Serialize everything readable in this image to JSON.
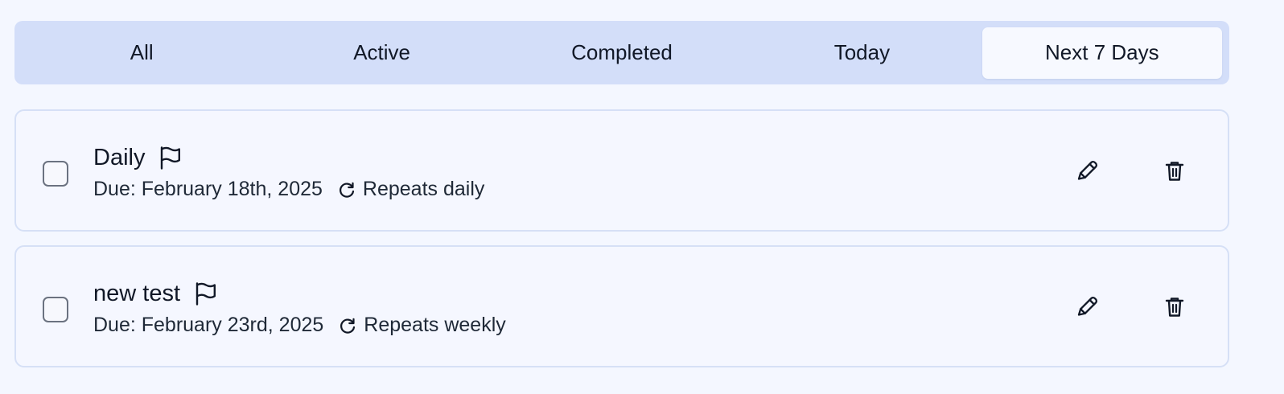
{
  "tabs": {
    "items": [
      {
        "label": "All",
        "active": false
      },
      {
        "label": "Active",
        "active": false
      },
      {
        "label": "Completed",
        "active": false
      },
      {
        "label": "Today",
        "active": false
      },
      {
        "label": "Next 7 Days",
        "active": true
      }
    ]
  },
  "tasks": [
    {
      "title": "Daily",
      "due": "Due: February 18th, 2025",
      "repeat": "Repeats daily",
      "completed": false,
      "icons": {
        "flag": "flag-icon",
        "repeat": "refresh-icon",
        "edit": "pencil-icon",
        "delete": "trash-icon"
      }
    },
    {
      "title": "new test",
      "due": "Due: February 23rd, 2025",
      "repeat": "Repeats weekly",
      "completed": false,
      "icons": {
        "flag": "flag-icon",
        "repeat": "refresh-icon",
        "edit": "pencil-icon",
        "delete": "trash-icon"
      }
    }
  ],
  "colors": {
    "page_background": "#f4f7ff",
    "tab_bar_background": "#d3def9",
    "active_tab_background": "#f7f9ff",
    "card_border": "#d6e0f6",
    "text": "#111827"
  }
}
